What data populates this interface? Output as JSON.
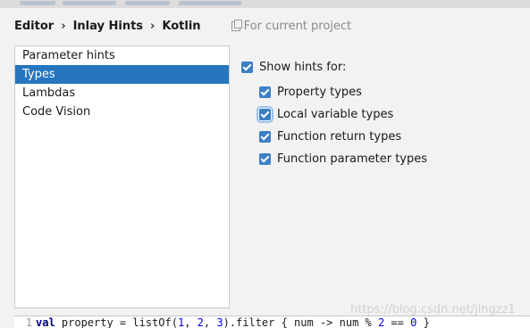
{
  "breadcrumb": {
    "items": [
      "Editor",
      "Inlay Hints",
      "Kotlin"
    ],
    "separator": "›",
    "scope_label": "For current project"
  },
  "list": {
    "items": [
      "Parameter hints",
      "Types",
      "Lambdas",
      "Code Vision"
    ],
    "selected": "Types"
  },
  "options": {
    "show_hints_label": "Show hints for:",
    "checkboxes": [
      {
        "label": "Property types",
        "checked": true
      },
      {
        "label": "Local variable types",
        "checked": true
      },
      {
        "label": "Function return types",
        "checked": true
      },
      {
        "label": "Function parameter types",
        "checked": true
      }
    ]
  },
  "editor": {
    "line_number": "1",
    "code": {
      "kw": "val",
      "name": " property = listOf(",
      "n1": "1",
      "c1": ", ",
      "n2": "2",
      "c2": ", ",
      "n3": "3",
      "rest": ").filter { num -> num % ",
      "n4": "2",
      "eq": " == ",
      "n5": "0",
      "close": " }"
    }
  },
  "watermark": "https://blog.csdn.net/jingzz1",
  "colors": {
    "accent": "#2675bf",
    "checkbox": "#3d7fc4"
  }
}
